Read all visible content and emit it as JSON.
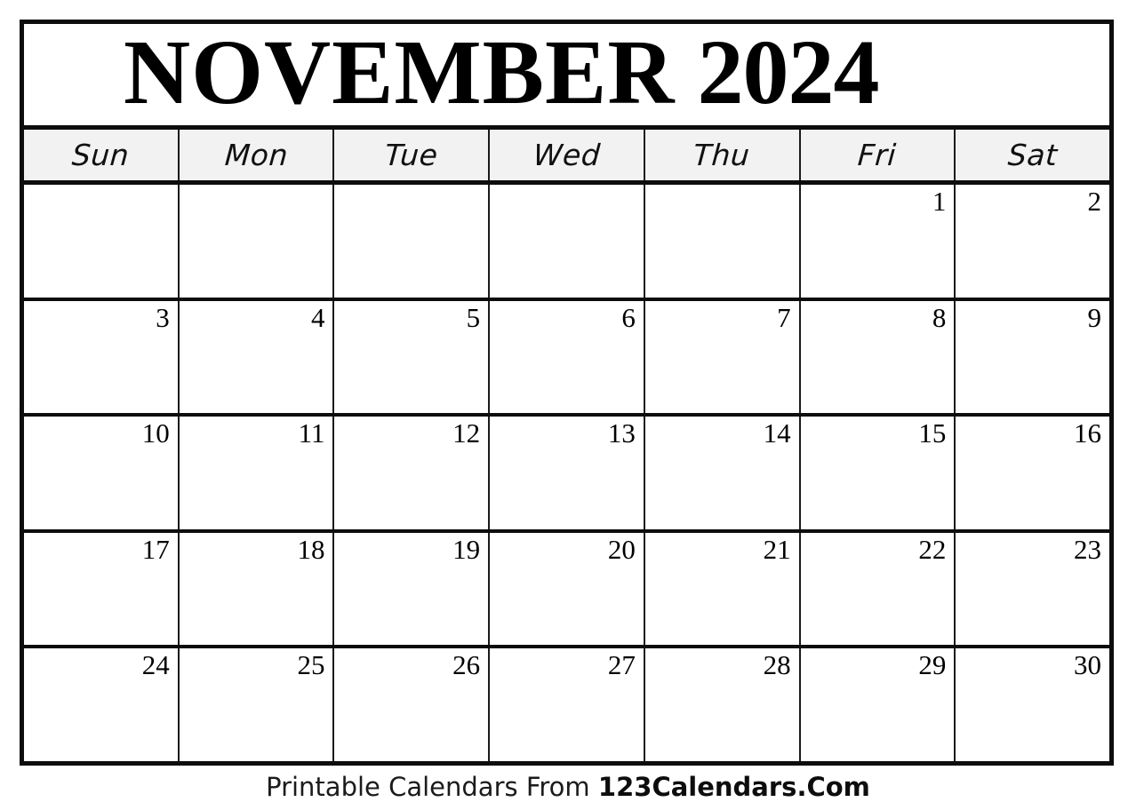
{
  "calendar": {
    "title": {
      "month": "NOVEMBER",
      "year": "2024",
      "full": "NOVEMBER 2024"
    },
    "weekday_headers": [
      "Sun",
      "Mon",
      "Tue",
      "Wed",
      "Thu",
      "Fri",
      "Sat"
    ],
    "weeks": [
      [
        "",
        "",
        "",
        "",
        "",
        "1",
        "2"
      ],
      [
        "3",
        "4",
        "5",
        "6",
        "7",
        "8",
        "9"
      ],
      [
        "10",
        "11",
        "12",
        "13",
        "14",
        "15",
        "16"
      ],
      [
        "17",
        "18",
        "19",
        "20",
        "21",
        "22",
        "23"
      ],
      [
        "24",
        "25",
        "26",
        "27",
        "28",
        "29",
        "30"
      ]
    ]
  },
  "footer": {
    "prefix": "Printable Calendars From ",
    "brand": "123Calendars.Com"
  },
  "colors": {
    "border": "#0d0d0d",
    "grid_line": "#1a1a1a",
    "header_background": "#f2f2f2",
    "page_background": "#ffffff",
    "text": "#000000"
  }
}
